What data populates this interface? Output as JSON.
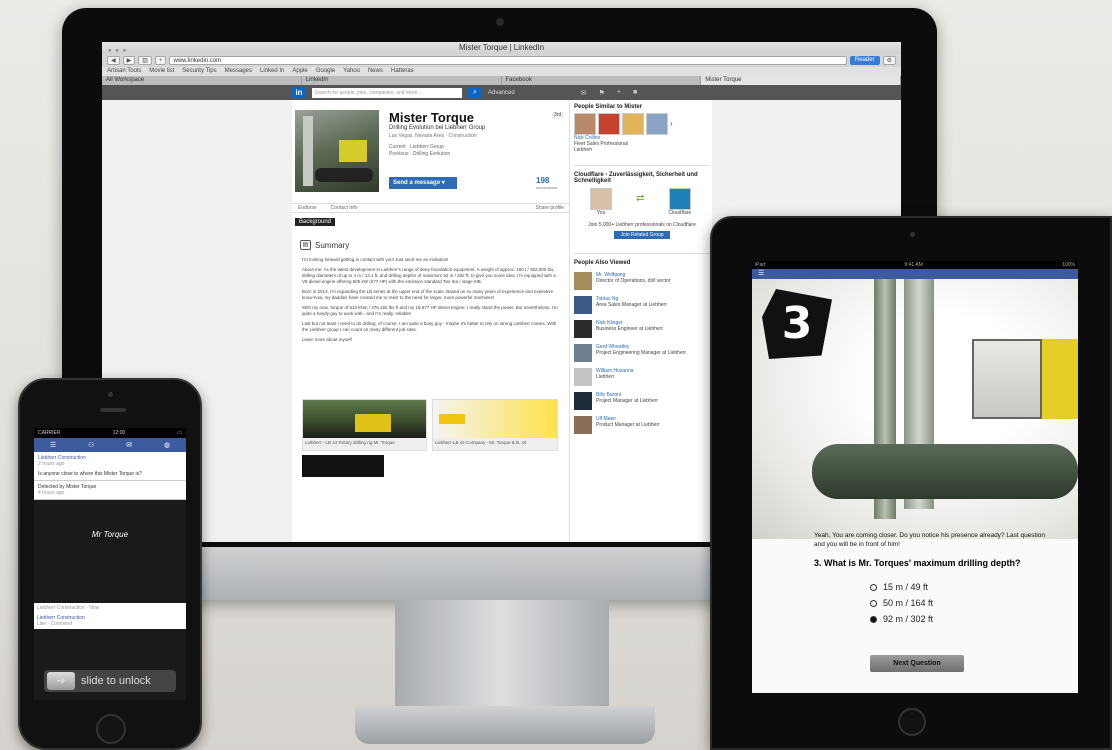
{
  "imac": {
    "window_title": "Mister Torque | LinkedIn",
    "url": "www.linkedin.com",
    "go_label": "Reader",
    "bookmarks": [
      "Artisan Tools",
      "Movie list",
      "Security Tips",
      "Messages",
      "Linked In",
      "Apple",
      "Google",
      "Yahoo",
      "News",
      "Hatteras"
    ],
    "tabs": [
      "All Workspace",
      "LinkedIn",
      "Facebook",
      "Mister Torque"
    ],
    "linkedin": {
      "logo": "in",
      "search_placeholder": "Search for people, jobs, companies, and more...",
      "advanced": "Advanced",
      "profile": {
        "name": "Mister Torque",
        "headline": "Drilling Evolution bei Liebherr Group",
        "location": "Las Vegas, Nevada Area · Construction",
        "current_label": "Current",
        "current_value": "Liebherr Group",
        "previous_label": "Previous",
        "previous_value": "Drilling Evolution",
        "badge": "3rd",
        "send_button": "Send a message",
        "connections": "198",
        "connections_label": "connections",
        "strip_endorse": "Endorse",
        "strip_contact": "Contact Info",
        "strip_share": "Share profile",
        "background_tab": "Background",
        "summary_title": "Summary",
        "summary_paragraphs": [
          "I'm looking forward getting in contact with you! Just send me an invitation!",
          "About me: As the latest development in Liebherr's range of deep foundation equipment. A weight of approx. 160 t / 352,000 lbs, drilling diameters of up to 4 m / 13.1 ft, and drilling depths of maximum 92 m / 302 ft; to give you some idea. I'm equipped with a V8 diesel engine offering 505 kW (677 HP) with the emission standard Tier IIIa / stage IIIB.",
          "Born in 2013, I'm expanding the LB series at the upper end of the scale. Based on so many years of experience and extensive know-how, my daddies have created me to react to the need for larger, more powerful machines!",
          "With my max. torque of 510 kNm / 376,150 lbs ft and my 19,677 HP diesel engine, I really stand the power. But nevertheless, I'm quite a handy guy to work with - and I'm really, reliable!",
          "Last but not least I need to do drilling, of course, I am quite a busy guy - maybe it's better to rely on strong Liebherr cranes. With the Liebherr group I can count on many different job sites.",
          "Learn more about myself"
        ],
        "media_1_caption": "Liebherr - LB 44 Rotary drilling rig Mr. Torque",
        "media_2_caption": "Liebherr-LB 44 Company - Mr. Torque & B. 44"
      },
      "right": {
        "similar_title": "People Similar to Mister",
        "similar_name": "Nick Collins",
        "similar_role": "Fleet Sales Professional",
        "similar_sub": "Liebherr",
        "ad_title": "Cloudflare - Zuverlässigkeit, Sicherheit und Schnelligkeit",
        "ad_text": "Join 5,000+ Liebherr professionals on Cloudflare",
        "ad_you": "You",
        "ad_other": "Cloudflare",
        "join_button": "Join Related Group",
        "viewed_title": "People Also Viewed",
        "viewed": [
          {
            "name": "Mr. Wolfgang",
            "role": "Director of Operations, drill sector"
          },
          {
            "name": "Tobias Ng",
            "role": "Area Sales Manager at Liebherr"
          },
          {
            "name": "Nick Klinger",
            "role": "Business Engineer at Liebherr"
          },
          {
            "name": "Gerd Wheatley",
            "role": "Project Engineering Manager at Liebherr"
          },
          {
            "name": "William Hosanna",
            "role": "Liebherr"
          },
          {
            "name": "Billy Baroni",
            "role": "Project Manager at Liebherr"
          },
          {
            "name": "Ulf Maier",
            "role": "Product Manager at Liebherr"
          }
        ]
      }
    }
  },
  "iphone": {
    "carrier": "CARRIER",
    "time": "12:00",
    "post_title": "Liebherr Construction",
    "post_sub": "2 hours ago",
    "post_text": "Is anyone close to where this Mister Torque is?",
    "post2_text": "Detected by Mister Torque",
    "post2_sub": "4 hours ago",
    "logo": "Mr Torque",
    "lower_header": "Liebherr Construction · Now",
    "lower_item": "Liebherr Construction",
    "lower_sub": "Like · Comment",
    "slide_label": "slide to unlock"
  },
  "ipad": {
    "status_left": "iPad",
    "status_time": "9:41 AM",
    "status_right": "100%",
    "step_number": "3",
    "intro_text": "Yeah. You are coming closer. Do you notice his presence already? Last question and you will be in front of him!",
    "question": "3. What is Mr. Torques' maximum drilling depth?",
    "options": [
      "15 m / 49 ft",
      "50 m / 164 ft",
      "92 m / 302 ft"
    ],
    "selected_option": 2,
    "next_button": "Next Question"
  }
}
